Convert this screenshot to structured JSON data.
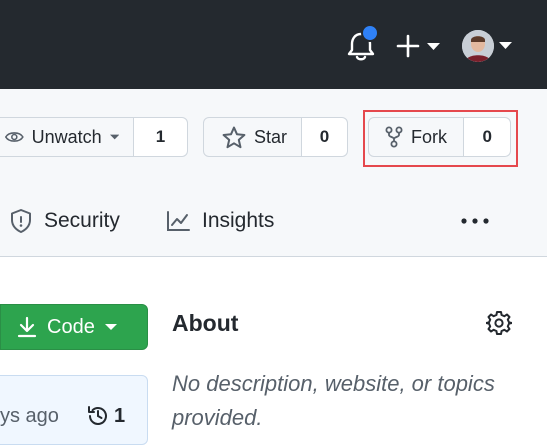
{
  "header": {
    "icons": [
      "bell-icon",
      "plus-icon",
      "chevron-down-icon",
      "avatar"
    ],
    "accent": "#2f81f7",
    "background": "#24292f"
  },
  "repo_actions": {
    "watch": {
      "label": "Unwatch",
      "count": "1"
    },
    "star": {
      "label": "Star",
      "count": "0"
    },
    "fork": {
      "label": "Fork",
      "count": "0",
      "highlight_color": "#e5484d"
    }
  },
  "tabs": [
    {
      "label": "Security",
      "icon": "shield-icon"
    },
    {
      "label": "Insights",
      "icon": "graph-icon"
    }
  ],
  "code_button": {
    "label": "Code",
    "color": "#2da44e"
  },
  "commit": {
    "time": "ys ago",
    "history_count": "1"
  },
  "about": {
    "title": "About",
    "description": "No description, website, or topics provided."
  }
}
